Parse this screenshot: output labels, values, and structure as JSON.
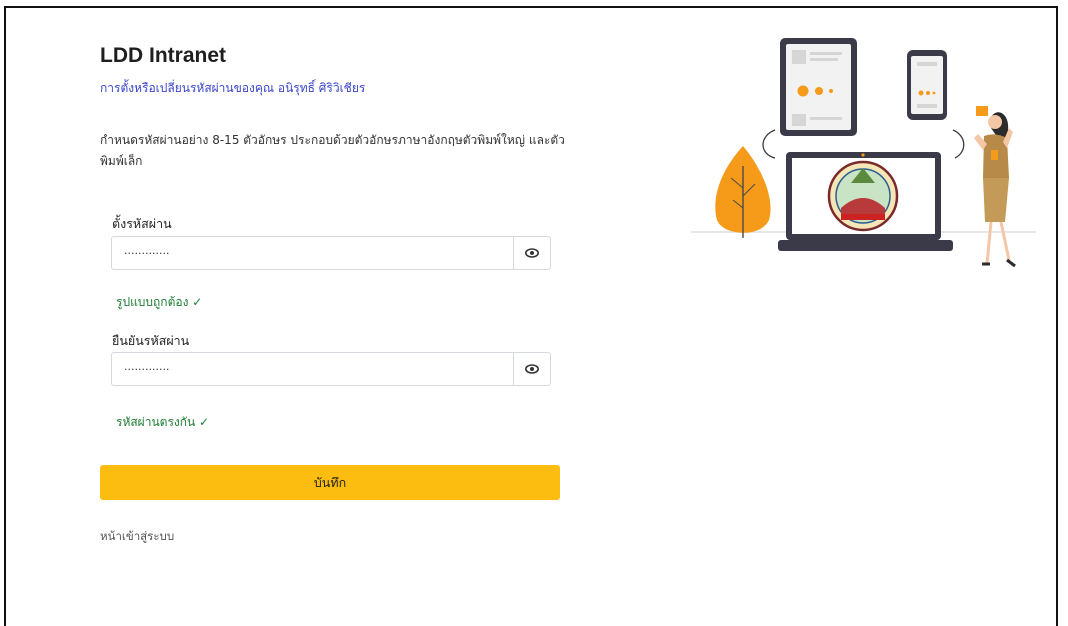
{
  "app_title": "LDD Intranet",
  "subtitle": "การตั้งหรือเปลี่ยนรหัสผ่านของคุณ อนิรุทธิ์ ศิริวิเชียร",
  "hint": "กำหนดรหัสผ่านอย่าง 8-15 ตัวอักษร ประกอบด้วยตัวอักษรภาษาอังกฤษตัวพิมพ์ใหญ่ และตัวพิมพ์เล็ก",
  "new_password": {
    "label": "ตั้งรหัสผ่าน",
    "value": "·············",
    "status": "รูปแบบถูกต้อง ✓"
  },
  "confirm_password": {
    "label": "ยืนยันรหัสผ่าน",
    "value": "·············",
    "status": "รหัสผ่านตรงกัน ✓"
  },
  "save_button": "บันทึก",
  "login_link": "หน้าเข้าสู่ระบบ",
  "icons": {
    "toggle_visibility": "eye-icon"
  },
  "colors": {
    "accent_button": "#fcbd10",
    "subtitle_text": "#3a46c9",
    "valid_text": "#1e7e34",
    "illustration_orange": "#f5a623"
  }
}
